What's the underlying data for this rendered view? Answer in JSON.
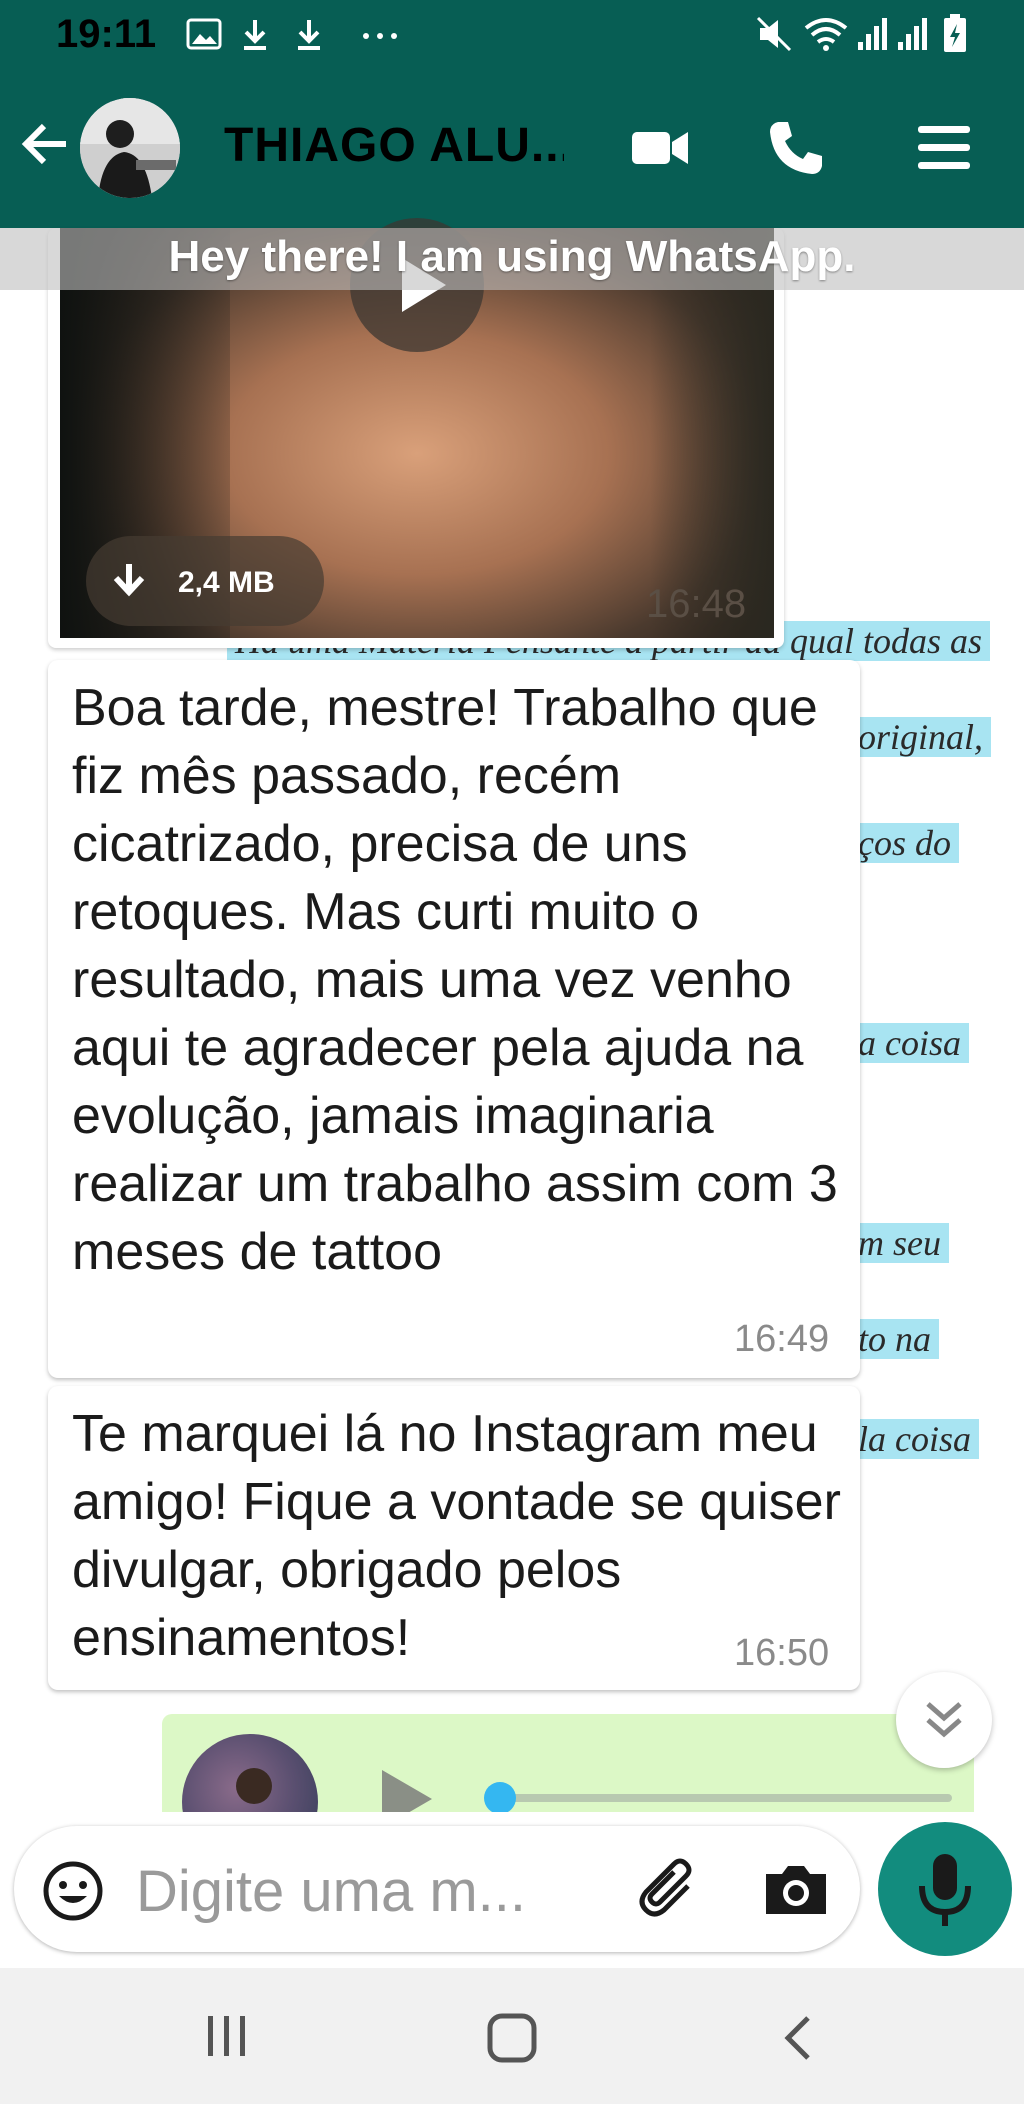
{
  "status_bar": {
    "time": "19:11"
  },
  "header": {
    "contact_name": "THIAGO ALU...",
    "contact_status": "Hey there! I am using WhatsApp."
  },
  "background_doc": {
    "lines": [
      "Há uma Matéria Pensante a partir da qual todas as",
      "original,",
      "ços do",
      "a coisa",
      "m seu",
      "to na",
      "la coisa"
    ]
  },
  "video_message": {
    "size": "2,4 MB",
    "time": "16:48"
  },
  "messages": [
    {
      "text": "Boa tarde, mestre! Trabalho que fiz mês passado, recém cicatrizado, precisa de uns retoques. Mas curti muito o resultado, mais uma vez venho aqui te agradecer pela ajuda na evolução, jamais imaginaria realizar um trabalho assim com 3 meses de tattoo",
      "time": "16:49"
    },
    {
      "text": "Te marquei lá no Instagram meu amigo! Fique a vontade se quiser divulgar, obrigado pelos ensinamentos!",
      "time": "16:50"
    }
  ],
  "audio_message": {
    "progress": 0
  },
  "composer": {
    "placeholder": "Digite uma m..."
  },
  "icons": {
    "back": "arrow-left-icon",
    "video_call": "video-camera-icon",
    "voice_call": "phone-icon",
    "menu": "menu-icon",
    "emoji": "emoji-icon",
    "attach": "paperclip-icon",
    "camera": "camera-icon",
    "mic": "microphone-icon",
    "download": "download-icon",
    "play": "play-icon",
    "scroll_down": "double-chevron-down-icon"
  },
  "colors": {
    "header": "#075e54",
    "mic_button": "#128c7e",
    "outgoing_bubble": "#dcf8c6",
    "highlight": "#a8e4f2",
    "audio_progress": "#34b7f1"
  }
}
